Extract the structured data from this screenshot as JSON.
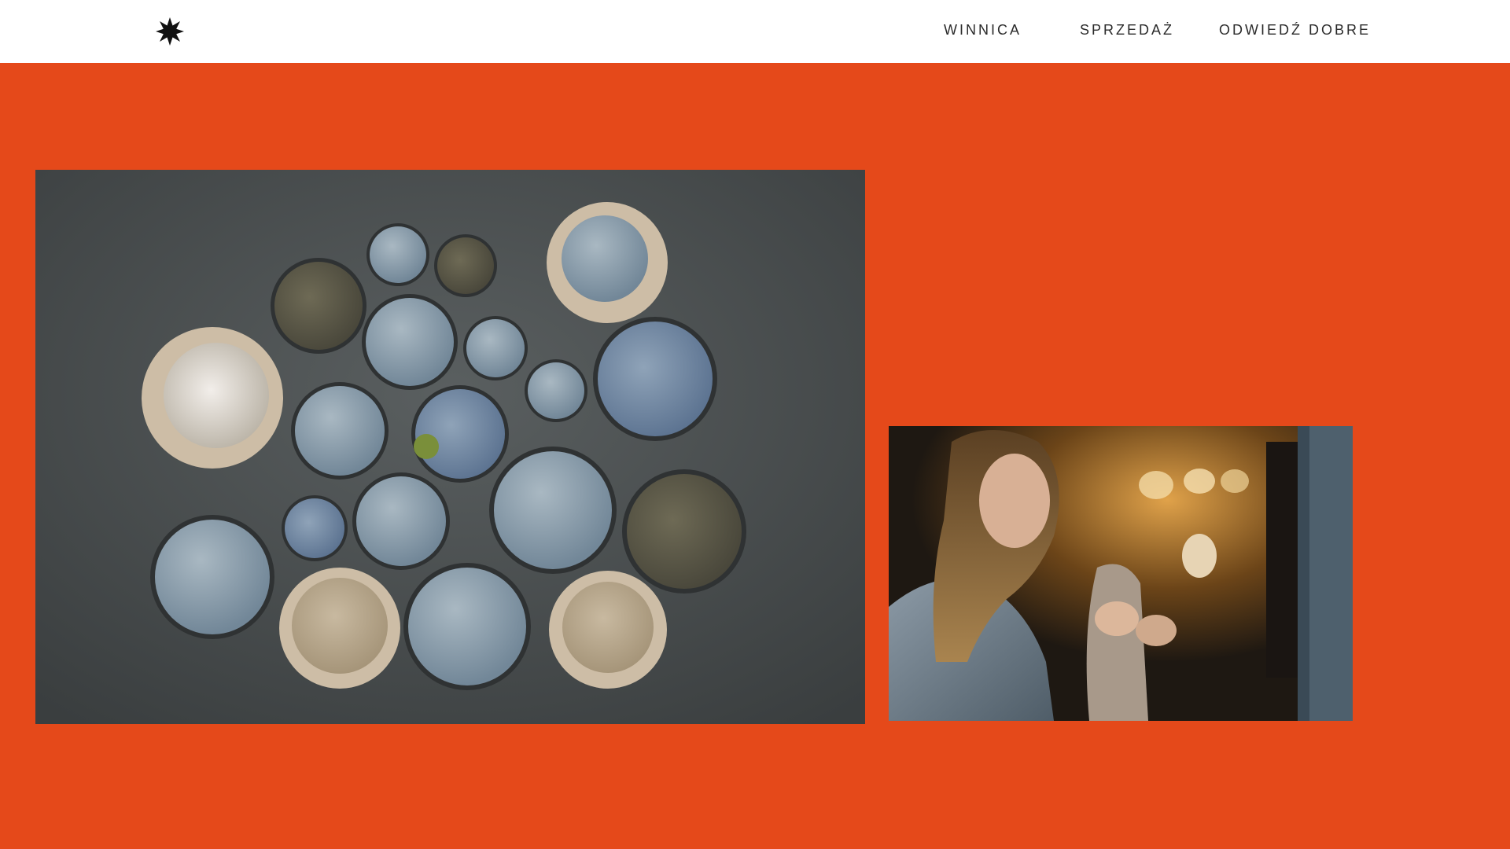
{
  "header": {
    "logo_icon": "star-burst-icon",
    "nav": [
      {
        "label": "WINNICA"
      },
      {
        "label": "SPRZEDAŻ"
      },
      {
        "label": "ODWIEDŹ DOBRE"
      }
    ]
  },
  "hero": {
    "background_color": "#e5491a",
    "images": [
      {
        "subject": "ceramic-plates-photo"
      },
      {
        "subject": "potter-woman-photo"
      }
    ]
  }
}
